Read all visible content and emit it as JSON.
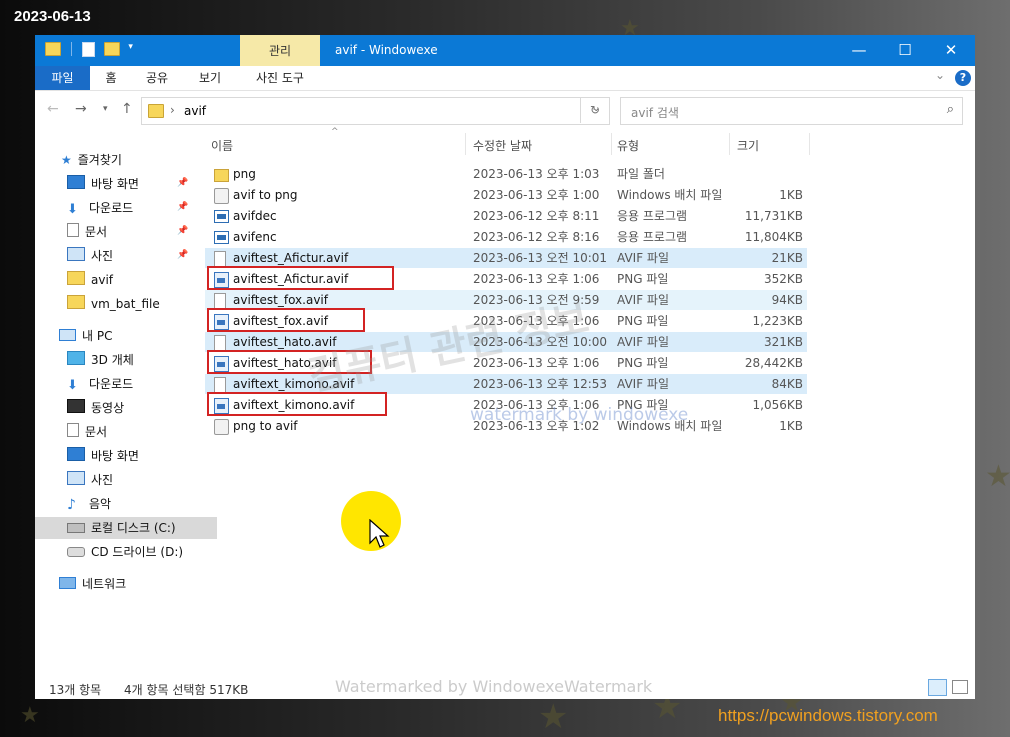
{
  "date_stamp": "2023-06-13",
  "site_url": "https://pcwindows.tistory.com",
  "colors": {
    "titlebar": "#0b79d6",
    "selected_row": "#d9ecfa",
    "highlight_box": "#d32323",
    "cursor_highlight": "#ffe600"
  },
  "titlebar": {
    "context_tab": "관리",
    "title": "avif   - Windowexe",
    "minimize": "—",
    "maximize": "☐",
    "close": "✕"
  },
  "ribbon": {
    "tabs": [
      "파일",
      "홈",
      "공유",
      "보기",
      "사진 도구"
    ],
    "help": "?",
    "expand": "⌄"
  },
  "address": {
    "path": "avif",
    "search_placeholder": "avif 검색",
    "separator": "›"
  },
  "nav": {
    "quick_access": "즐겨찾기",
    "quick_items": [
      {
        "label": "바탕 화면",
        "icon": "desktop-icon",
        "pinned": true
      },
      {
        "label": "다운로드",
        "icon": "download-icon",
        "pinned": true
      },
      {
        "label": "문서",
        "icon": "document-icon",
        "pinned": true
      },
      {
        "label": "사진",
        "icon": "pictures-icon",
        "pinned": true
      },
      {
        "label": "avif",
        "icon": "folder-icon",
        "pinned": false
      },
      {
        "label": "vm_bat_file",
        "icon": "folder-icon",
        "pinned": false
      }
    ],
    "this_pc": "내 PC",
    "pc_items": [
      {
        "label": "3D 개체",
        "icon": "3d-objects-icon"
      },
      {
        "label": "다운로드",
        "icon": "download-icon"
      },
      {
        "label": "동영상",
        "icon": "video-icon"
      },
      {
        "label": "문서",
        "icon": "document-icon"
      },
      {
        "label": "바탕 화면",
        "icon": "desktop-icon"
      },
      {
        "label": "사진",
        "icon": "pictures-icon"
      },
      {
        "label": "음악",
        "icon": "music-icon"
      },
      {
        "label": "로컬 디스크 (C:)",
        "icon": "drive-icon"
      },
      {
        "label": "CD 드라이브 (D:)",
        "icon": "cd-drive-icon"
      }
    ],
    "network": "네트워크"
  },
  "columns": {
    "name": "이름",
    "date": "수정한 날짜",
    "type": "유형",
    "size": "크기"
  },
  "files": [
    {
      "name": "png",
      "date": "2023-06-13 오후 1:03",
      "type": "파일 폴더",
      "size": "",
      "icon": "folder",
      "state": "",
      "boxed": false
    },
    {
      "name": "avif to png",
      "date": "2023-06-13 오후 1:00",
      "type": "Windows 배치 파일",
      "size": "1KB",
      "icon": "bat",
      "state": "",
      "boxed": false
    },
    {
      "name": "avifdec",
      "date": "2023-06-12 오후 8:11",
      "type": "응용 프로그램",
      "size": "11,731KB",
      "icon": "app",
      "state": "",
      "boxed": false
    },
    {
      "name": "avifenc",
      "date": "2023-06-12 오후 8:16",
      "type": "응용 프로그램",
      "size": "11,804KB",
      "icon": "app",
      "state": "",
      "boxed": false
    },
    {
      "name": "aviftest_Afictur.avif",
      "date": "2023-06-13 오전 10:01",
      "type": "AVIF 파일",
      "size": "21KB",
      "icon": "doc",
      "state": "sel",
      "boxed": false
    },
    {
      "name": "aviftest_Afictur.avif",
      "date": "2023-06-13 오후 1:06",
      "type": "PNG 파일",
      "size": "352KB",
      "icon": "png",
      "state": "",
      "boxed": true
    },
    {
      "name": "aviftest_fox.avif",
      "date": "2023-06-13 오전 9:59",
      "type": "AVIF 파일",
      "size": "94KB",
      "icon": "doc",
      "state": "hov",
      "boxed": false
    },
    {
      "name": "aviftest_fox.avif",
      "date": "2023-06-13 오후 1:06",
      "type": "PNG 파일",
      "size": "1,223KB",
      "icon": "png",
      "state": "",
      "boxed": true
    },
    {
      "name": "aviftest_hato.avif",
      "date": "2023-06-13 오전 10:00",
      "type": "AVIF 파일",
      "size": "321KB",
      "icon": "doc",
      "state": "sel",
      "boxed": false
    },
    {
      "name": "aviftest_hato.avif",
      "date": "2023-06-13 오후 1:06",
      "type": "PNG 파일",
      "size": "28,442KB",
      "icon": "png",
      "state": "",
      "boxed": true
    },
    {
      "name": "aviftext_kimono.avif",
      "date": "2023-06-13 오후 12:53",
      "type": "AVIF 파일",
      "size": "84KB",
      "icon": "doc",
      "state": "sel",
      "boxed": false
    },
    {
      "name": "aviftext_kimono.avif",
      "date": "2023-06-13 오후 1:06",
      "type": "PNG 파일",
      "size": "1,056KB",
      "icon": "png",
      "state": "",
      "boxed": true
    },
    {
      "name": "png to avif",
      "date": "2023-06-13 오후 1:02",
      "type": "Windows 배치 파일",
      "size": "1KB",
      "icon": "bat",
      "state": "",
      "boxed": false
    }
  ],
  "status": {
    "count": "13개 항목",
    "selection": "4개 항목 선택함 517KB"
  },
  "watermarks": {
    "center_korean": "컴퓨터 관련 정보",
    "center_english": "watermark by windowexe",
    "bottom": "Watermarked by WindowexeWatermark"
  }
}
